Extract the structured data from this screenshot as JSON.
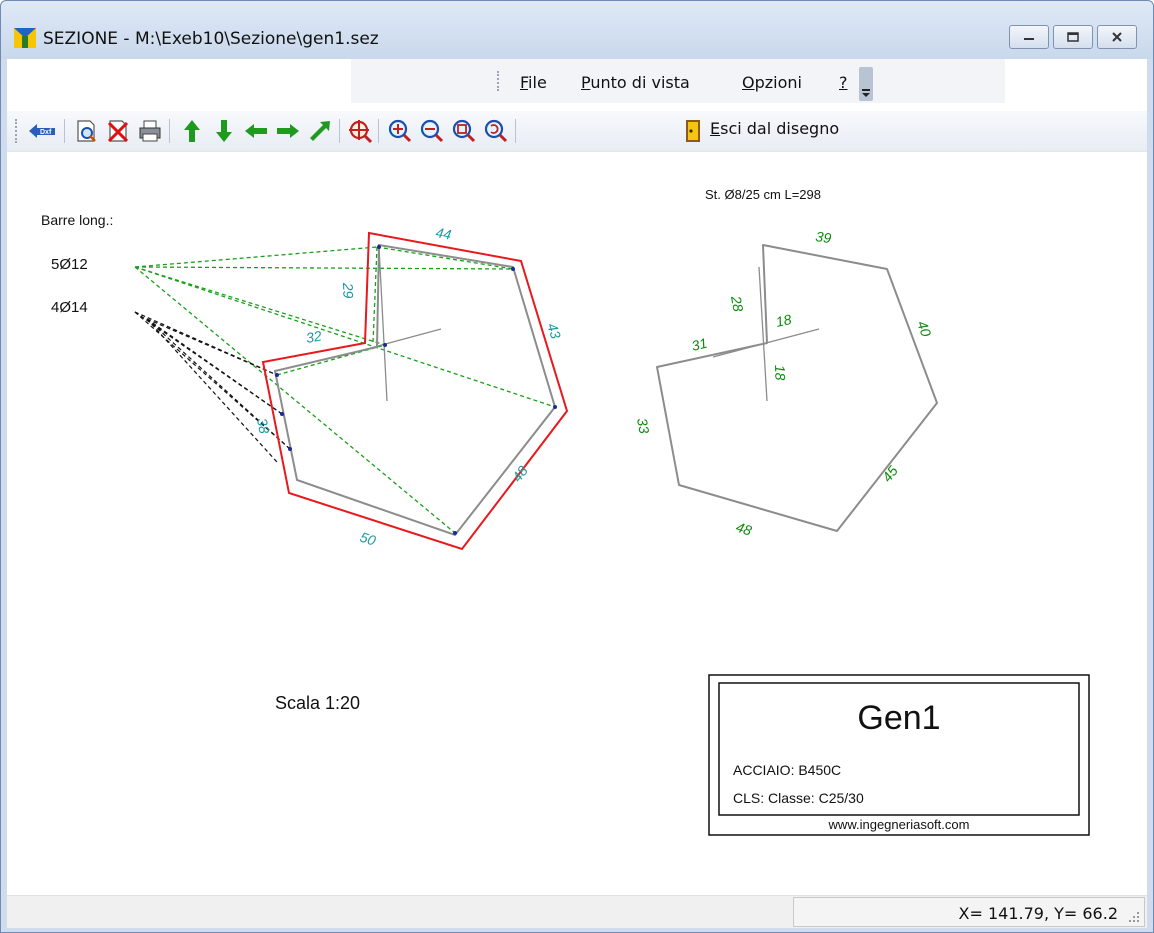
{
  "window": {
    "title": "SEZIONE - M:\\Exeb10\\Sezione\\gen1.sez"
  },
  "menu": {
    "items": [
      {
        "label": "File",
        "u": "F",
        "rest": "ile"
      },
      {
        "label": "Punto di vista",
        "u": "P",
        "rest": "unto di vista"
      },
      {
        "label": "Opzioni",
        "u": "O",
        "rest": "pzioni"
      },
      {
        "label": "?",
        "u": "?",
        "rest": ""
      }
    ]
  },
  "toolbar": {
    "dxf_label": "Dxf",
    "exit_u": "E",
    "exit_rest": "sci dal disegno",
    "icons": [
      "dxf-export-icon",
      "print-preview-icon",
      "delete-icon",
      "print-icon",
      "arrow-up-icon",
      "arrow-down-icon",
      "arrow-left-icon",
      "arrow-right-icon",
      "arrow-diagonal-icon",
      "zoom-window-icon",
      "zoom-in-icon",
      "zoom-out-icon",
      "zoom-extents-icon",
      "zoom-previous-icon",
      "exit-icon"
    ]
  },
  "drawing": {
    "bars_title": "Barre long.:",
    "bars": [
      "5Ø12",
      "4Ø14"
    ],
    "section_dims": [
      "44",
      "29",
      "43",
      "32",
      "38",
      "48",
      "50"
    ],
    "stirrup_title": "St. Ø8/25 cm L=298",
    "stirrup_dims": [
      "39",
      "28",
      "18",
      "40",
      "31",
      "18",
      "33",
      "45",
      "48"
    ],
    "scale": "Scala 1:20",
    "colors": {
      "concrete_outline": "#e8181c",
      "rebar_line": "#8c8c8c",
      "dim_teal": "#1a9aa0",
      "dim_green": "#0b8a0b",
      "leader_green": "#18a018",
      "leader_black": "#000000"
    }
  },
  "title_block": {
    "name": "Gen1",
    "steel": "ACCIAIO: B450C",
    "concrete": "CLS: Classe: C25/30",
    "website": "www.ingegneriasoft.com"
  },
  "status": {
    "coords": "X= 141.79, Y= 66.2"
  }
}
